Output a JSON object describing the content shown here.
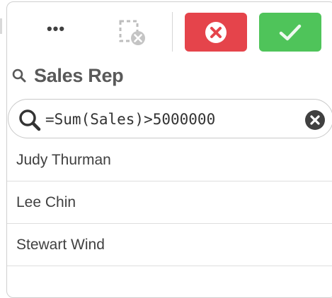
{
  "toolbar": {
    "more_label": "•••",
    "icons": {
      "more": "more-dots-icon",
      "clear_selections": "clear-selections-icon",
      "cancel": "close-circle-icon",
      "confirm": "checkmark-icon"
    },
    "colors": {
      "cancel": "#e5444b",
      "confirm": "#4fc45a"
    }
  },
  "title": "Sales Rep",
  "search": {
    "value": "=Sum(Sales)>5000000",
    "icon": "search-icon",
    "clear_icon": "clear-circle-icon"
  },
  "list": [
    "Judy Thurman",
    "Lee Chin",
    "Stewart Wind"
  ]
}
